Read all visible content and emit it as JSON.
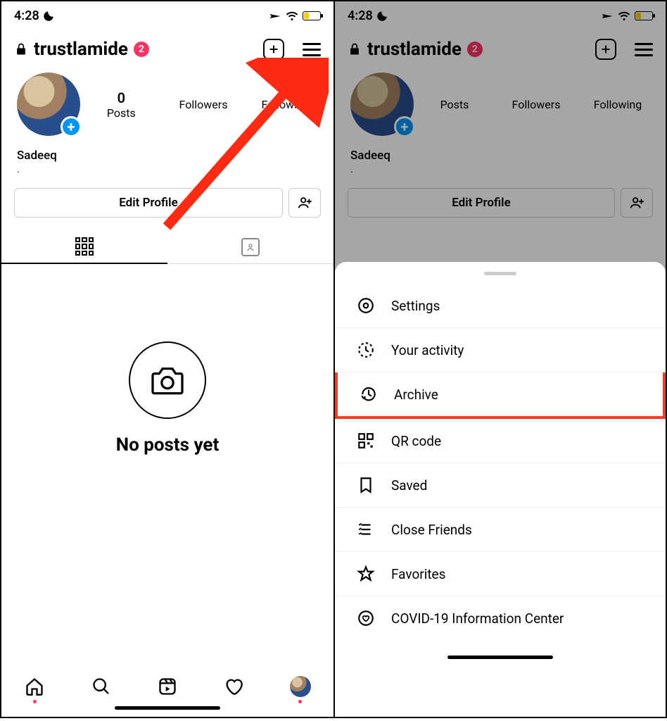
{
  "status": {
    "time": "4:28"
  },
  "header": {
    "username": "trustlamide",
    "badge_count": "2"
  },
  "stats": {
    "posts_count": "0",
    "posts_label": "Posts",
    "followers_label": "Followers",
    "following_label": "Following"
  },
  "profile": {
    "display_name": "Sadeeq",
    "subtitle": "."
  },
  "actions": {
    "edit_label": "Edit Profile"
  },
  "empty": {
    "no_posts": "No posts yet"
  },
  "menu": {
    "items": [
      {
        "id": "settings",
        "label": "Settings"
      },
      {
        "id": "activity",
        "label": "Your activity"
      },
      {
        "id": "archive",
        "label": "Archive"
      },
      {
        "id": "qrcode",
        "label": "QR code"
      },
      {
        "id": "saved",
        "label": "Saved"
      },
      {
        "id": "closefriends",
        "label": "Close Friends"
      },
      {
        "id": "favorites",
        "label": "Favorites"
      },
      {
        "id": "covid",
        "label": "COVID-19 Information Center"
      }
    ]
  }
}
